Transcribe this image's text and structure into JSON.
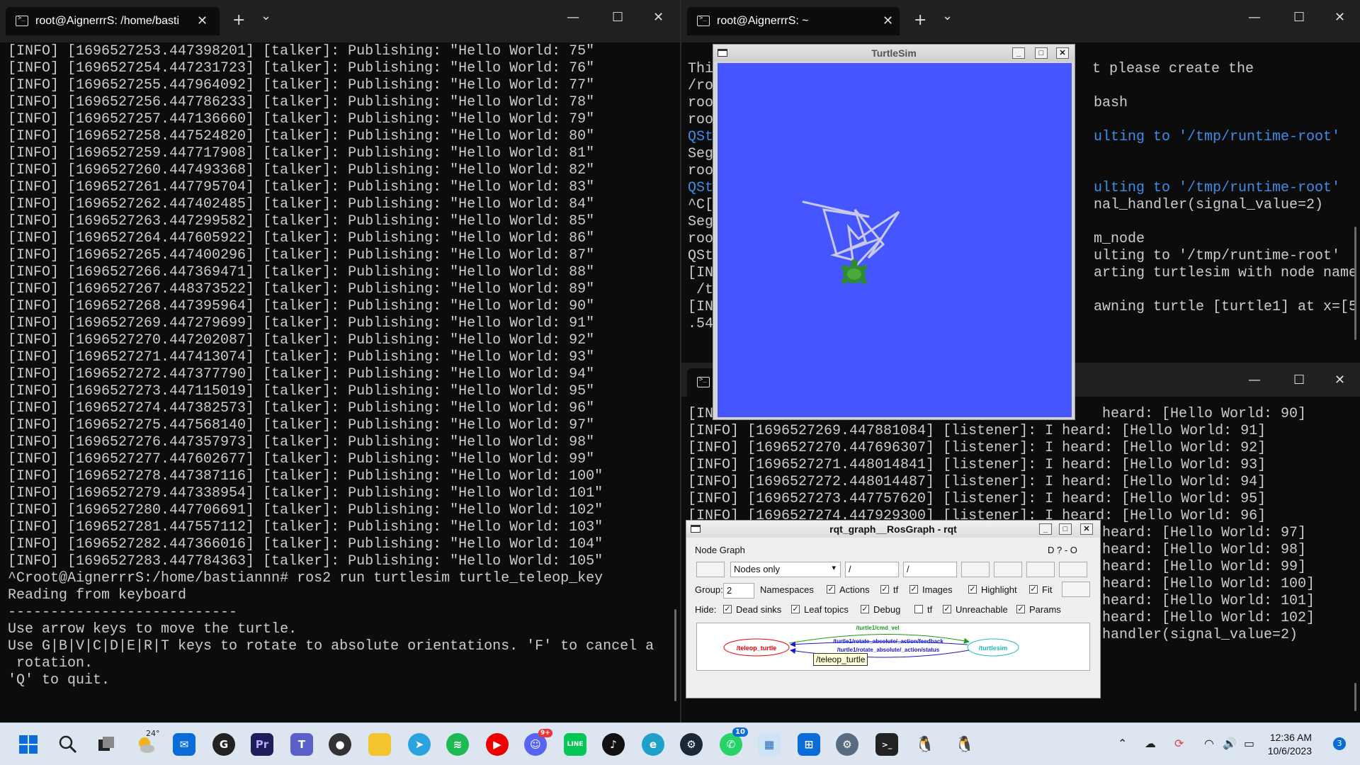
{
  "left_terminal": {
    "tab_title": "root@AignerrrS: /home/basti",
    "new_tab": "+",
    "dropdown": "⌄",
    "minimize": "—",
    "maximize": "☐",
    "close": "✕",
    "lines": [
      "[INFO] [1696527253.447398201] [talker]: Publishing: \"Hello World: 75\"",
      "[INFO] [1696527254.447231723] [talker]: Publishing: \"Hello World: 76\"",
      "[INFO] [1696527255.447964092] [talker]: Publishing: \"Hello World: 77\"",
      "[INFO] [1696527256.447786233] [talker]: Publishing: \"Hello World: 78\"",
      "[INFO] [1696527257.447136660] [talker]: Publishing: \"Hello World: 79\"",
      "[INFO] [1696527258.447524820] [talker]: Publishing: \"Hello World: 80\"",
      "[INFO] [1696527259.447717908] [talker]: Publishing: \"Hello World: 81\"",
      "[INFO] [1696527260.447493368] [talker]: Publishing: \"Hello World: 82\"",
      "[INFO] [1696527261.447795704] [talker]: Publishing: \"Hello World: 83\"",
      "[INFO] [1696527262.447402485] [talker]: Publishing: \"Hello World: 84\"",
      "[INFO] [1696527263.447299582] [talker]: Publishing: \"Hello World: 85\"",
      "[INFO] [1696527264.447605922] [talker]: Publishing: \"Hello World: 86\"",
      "[INFO] [1696527265.447400296] [talker]: Publishing: \"Hello World: 87\"",
      "[INFO] [1696527266.447369471] [talker]: Publishing: \"Hello World: 88\"",
      "[INFO] [1696527267.448373522] [talker]: Publishing: \"Hello World: 89\"",
      "[INFO] [1696527268.447395964] [talker]: Publishing: \"Hello World: 90\"",
      "[INFO] [1696527269.447279699] [talker]: Publishing: \"Hello World: 91\"",
      "[INFO] [1696527270.447202087] [talker]: Publishing: \"Hello World: 92\"",
      "[INFO] [1696527271.447413074] [talker]: Publishing: \"Hello World: 93\"",
      "[INFO] [1696527272.447377790] [talker]: Publishing: \"Hello World: 94\"",
      "[INFO] [1696527273.447115019] [talker]: Publishing: \"Hello World: 95\"",
      "[INFO] [1696527274.447382573] [talker]: Publishing: \"Hello World: 96\"",
      "[INFO] [1696527275.447568140] [talker]: Publishing: \"Hello World: 97\"",
      "[INFO] [1696527276.447357973] [talker]: Publishing: \"Hello World: 98\"",
      "[INFO] [1696527277.447602677] [talker]: Publishing: \"Hello World: 99\"",
      "[INFO] [1696527278.447387116] [talker]: Publishing: \"Hello World: 100\"",
      "[INFO] [1696527279.447338954] [talker]: Publishing: \"Hello World: 101\"",
      "[INFO] [1696527280.447706691] [talker]: Publishing: \"Hello World: 102\"",
      "[INFO] [1696527281.447557112] [talker]: Publishing: \"Hello World: 103\"",
      "[INFO] [1696527282.447366016] [talker]: Publishing: \"Hello World: 104\"",
      "[INFO] [1696527283.447784363] [talker]: Publishing: \"Hello World: 105\"",
      "^Croot@AignerrrS:/home/bastiannn# ros2 run turtlesim turtle_teleop_key",
      "Reading from keyboard",
      "---------------------------",
      "Use arrow keys to move the turtle.",
      "Use G|B|V|C|D|E|R|T keys to rotate to absolute orientations. 'F' to cancel a",
      " rotation.",
      "'Q' to quit."
    ]
  },
  "right_top_terminal": {
    "tab_title": "root@AignerrrS: ~",
    "new_tab": "+",
    "dropdown": "⌄",
    "minimize": "—",
    "maximize": "☐",
    "close": "✕",
    "lines": [
      {
        "left": "Thi",
        "right": "t please create the",
        "blue": false
      },
      {
        "left": "/ro",
        "right": "",
        "blue": false
      },
      {
        "left": "roo",
        "right": "bash",
        "blue": false
      },
      {
        "left": "roo",
        "right": "",
        "blue": false
      },
      {
        "left": "QSt",
        "right": "ulting to '/tmp/runtime-root'",
        "blue": true
      },
      {
        "left": "Seg",
        "right": "",
        "blue": false
      },
      {
        "left": "roo",
        "right": "",
        "blue": false
      },
      {
        "left": "QSt",
        "right": "ulting to '/tmp/runtime-root'",
        "blue": true
      },
      {
        "left": "^C[",
        "right": "nal_handler(signal_value=2)",
        "blue": false
      },
      {
        "left": "Seg",
        "right": "",
        "blue": false
      },
      {
        "left": "roo",
        "right": "m_node",
        "blue": false
      },
      {
        "left": "QSt",
        "right": "ulting to '/tmp/runtime-root'",
        "blue": false
      },
      {
        "left": "[IN",
        "right": "arting turtlesim with node name",
        "blue": false
      },
      {
        "left": " /t",
        "right": "",
        "blue": false
      },
      {
        "left": "[IN",
        "right": "awning turtle [turtle1] at x=[5",
        "blue": false
      },
      {
        "left": ".54",
        "right": "",
        "blue": false
      }
    ]
  },
  "right_bottom_terminal": {
    "minimize": "—",
    "maximize": "☐",
    "close": "✕",
    "lines": [
      {
        "text": "[IN",
        "right": "heard: [Hello World: 90]"
      },
      {
        "text": "[INFO] [1696527269.447881084] [listener]: I heard: [Hello World: 91]",
        "right": ""
      },
      {
        "text": "[INFO] [1696527270.447696307] [listener]: I heard: [Hello World: 92]",
        "right": ""
      },
      {
        "text": "[INFO] [1696527271.448014841] [listener]: I heard: [Hello World: 93]",
        "right": ""
      },
      {
        "text": "[INFO] [1696527272.448014487] [listener]: I heard: [Hello World: 94]",
        "right": ""
      },
      {
        "text": "[INFO] [1696527273.447757620] [listener]: I heard: [Hello World: 95]",
        "right": ""
      },
      {
        "text": "[INFO] [1696527274.447929300] [listener]: I heard: [Hello World: 96]",
        "right": ""
      },
      {
        "text": "",
        "right": "heard: [Hello World: 97]"
      },
      {
        "text": "",
        "right": "heard: [Hello World: 98]"
      },
      {
        "text": "",
        "right": "heard: [Hello World: 99]"
      },
      {
        "text": "",
        "right": "heard: [Hello World: 100]"
      },
      {
        "text": "",
        "right": "heard: [Hello World: 101]"
      },
      {
        "text": "",
        "right": "heard: [Hello World: 102]"
      },
      {
        "text": "",
        "right": "handler(signal_value=2)"
      }
    ]
  },
  "turtlesim": {
    "title": "TurtleSim",
    "bg_color": "#4556ff"
  },
  "rqt": {
    "title": "rqt_graph__RosGraph - rqt",
    "section": "Node Graph",
    "header_right": "D ?   - O",
    "mode_select": "Nodes only",
    "filter1": "/",
    "filter2": "/",
    "group_label": "Group:",
    "group_value": "2",
    "namespaces": "Namespaces",
    "actions": "Actions",
    "tf": "tf",
    "images": "Images",
    "highlight": "Highlight",
    "fit": "Fit",
    "hide_label": "Hide:",
    "dead_sinks": "Dead sinks",
    "leaf_topics": "Leaf topics",
    "debug": "Debug",
    "tf2": "tf",
    "unreachable": "Unreachable",
    "params": "Params",
    "graph": {
      "node_left": "/teleop_turtle",
      "node_right": "/turtlesim",
      "edge1": "/turtle1/cmd_vel",
      "edge2": "/turtle1/rotate_absolute/_action/feedback",
      "edge3": "/turtle1/rotate_absolute/_action/status",
      "tooltip": "/teleop_turtle"
    }
  },
  "taskbar": {
    "weather": "24°",
    "teams_badge": "",
    "discord_badge": "9+",
    "whatsapp_badge": "10",
    "time": "12:36 AM",
    "date": "10/6/2023",
    "notif_count": "3"
  }
}
